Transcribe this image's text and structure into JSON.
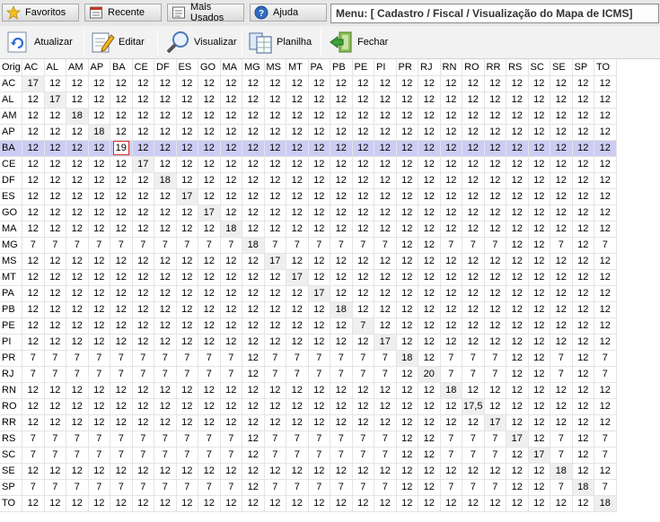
{
  "tabs": [
    {
      "label": "Favoritos",
      "icon": "star-icon"
    },
    {
      "label": "Recente",
      "icon": "recent-icon"
    },
    {
      "label": "Mais Usados",
      "icon": "most-used-icon"
    },
    {
      "label": "Ajuda",
      "icon": "help-icon"
    }
  ],
  "breadcrumb": "Menu: [ Cadastro / Fiscal / Visualização do Mapa de ICMS]",
  "toolbar": [
    {
      "label": "Atualizar",
      "icon": "refresh-icon"
    },
    {
      "label": "Editar",
      "icon": "edit-icon"
    },
    {
      "label": "Visualizar",
      "icon": "magnifier-icon"
    },
    {
      "label": "Planilha",
      "icon": "spreadsheet-icon"
    },
    {
      "label": "Fechar",
      "icon": "exit-icon"
    }
  ],
  "table": {
    "corner": "Orig",
    "columns": [
      "AC",
      "AL",
      "AM",
      "AP",
      "BA",
      "CE",
      "DF",
      "ES",
      "GO",
      "MA",
      "MG",
      "MS",
      "MT",
      "PA",
      "PB",
      "PE",
      "PI",
      "PR",
      "RJ",
      "RN",
      "RO",
      "RR",
      "RS",
      "SC",
      "SE",
      "SP",
      "TO"
    ],
    "selected_row": "BA",
    "active_cell": {
      "row": "BA",
      "col": "BA"
    },
    "rows": [
      {
        "orig": "AC",
        "values": [
          "17",
          "12",
          "12",
          "12",
          "12",
          "12",
          "12",
          "12",
          "12",
          "12",
          "12",
          "12",
          "12",
          "12",
          "12",
          "12",
          "12",
          "12",
          "12",
          "12",
          "12",
          "12",
          "12",
          "12",
          "12",
          "12",
          "12"
        ]
      },
      {
        "orig": "AL",
        "values": [
          "12",
          "17",
          "12",
          "12",
          "12",
          "12",
          "12",
          "12",
          "12",
          "12",
          "12",
          "12",
          "12",
          "12",
          "12",
          "12",
          "12",
          "12",
          "12",
          "12",
          "12",
          "12",
          "12",
          "12",
          "12",
          "12",
          "12"
        ]
      },
      {
        "orig": "AM",
        "values": [
          "12",
          "12",
          "18",
          "12",
          "12",
          "12",
          "12",
          "12",
          "12",
          "12",
          "12",
          "12",
          "12",
          "12",
          "12",
          "12",
          "12",
          "12",
          "12",
          "12",
          "12",
          "12",
          "12",
          "12",
          "12",
          "12",
          "12"
        ]
      },
      {
        "orig": "AP",
        "values": [
          "12",
          "12",
          "12",
          "18",
          "12",
          "12",
          "12",
          "12",
          "12",
          "12",
          "12",
          "12",
          "12",
          "12",
          "12",
          "12",
          "12",
          "12",
          "12",
          "12",
          "12",
          "12",
          "12",
          "12",
          "12",
          "12",
          "12"
        ]
      },
      {
        "orig": "BA",
        "values": [
          "12",
          "12",
          "12",
          "12",
          "19",
          "12",
          "12",
          "12",
          "12",
          "12",
          "12",
          "12",
          "12",
          "12",
          "12",
          "12",
          "12",
          "12",
          "12",
          "12",
          "12",
          "12",
          "12",
          "12",
          "12",
          "12",
          "12"
        ]
      },
      {
        "orig": "CE",
        "values": [
          "12",
          "12",
          "12",
          "12",
          "12",
          "17",
          "12",
          "12",
          "12",
          "12",
          "12",
          "12",
          "12",
          "12",
          "12",
          "12",
          "12",
          "12",
          "12",
          "12",
          "12",
          "12",
          "12",
          "12",
          "12",
          "12",
          "12"
        ]
      },
      {
        "orig": "DF",
        "values": [
          "12",
          "12",
          "12",
          "12",
          "12",
          "12",
          "18",
          "12",
          "12",
          "12",
          "12",
          "12",
          "12",
          "12",
          "12",
          "12",
          "12",
          "12",
          "12",
          "12",
          "12",
          "12",
          "12",
          "12",
          "12",
          "12",
          "12"
        ]
      },
      {
        "orig": "ES",
        "values": [
          "12",
          "12",
          "12",
          "12",
          "12",
          "12",
          "12",
          "17",
          "12",
          "12",
          "12",
          "12",
          "12",
          "12",
          "12",
          "12",
          "12",
          "12",
          "12",
          "12",
          "12",
          "12",
          "12",
          "12",
          "12",
          "12",
          "12"
        ]
      },
      {
        "orig": "GO",
        "values": [
          "12",
          "12",
          "12",
          "12",
          "12",
          "12",
          "12",
          "12",
          "17",
          "12",
          "12",
          "12",
          "12",
          "12",
          "12",
          "12",
          "12",
          "12",
          "12",
          "12",
          "12",
          "12",
          "12",
          "12",
          "12",
          "12",
          "12"
        ]
      },
      {
        "orig": "MA",
        "values": [
          "12",
          "12",
          "12",
          "12",
          "12",
          "12",
          "12",
          "12",
          "12",
          "18",
          "12",
          "12",
          "12",
          "12",
          "12",
          "12",
          "12",
          "12",
          "12",
          "12",
          "12",
          "12",
          "12",
          "12",
          "12",
          "12",
          "12"
        ]
      },
      {
        "orig": "MG",
        "values": [
          "7",
          "7",
          "7",
          "7",
          "7",
          "7",
          "7",
          "7",
          "7",
          "7",
          "18",
          "7",
          "7",
          "7",
          "7",
          "7",
          "7",
          "12",
          "12",
          "7",
          "7",
          "7",
          "12",
          "12",
          "7",
          "12",
          "7"
        ]
      },
      {
        "orig": "MS",
        "values": [
          "12",
          "12",
          "12",
          "12",
          "12",
          "12",
          "12",
          "12",
          "12",
          "12",
          "12",
          "17",
          "12",
          "12",
          "12",
          "12",
          "12",
          "12",
          "12",
          "12",
          "12",
          "12",
          "12",
          "12",
          "12",
          "12",
          "12"
        ]
      },
      {
        "orig": "MT",
        "values": [
          "12",
          "12",
          "12",
          "12",
          "12",
          "12",
          "12",
          "12",
          "12",
          "12",
          "12",
          "12",
          "17",
          "12",
          "12",
          "12",
          "12",
          "12",
          "12",
          "12",
          "12",
          "12",
          "12",
          "12",
          "12",
          "12",
          "12"
        ]
      },
      {
        "orig": "PA",
        "values": [
          "12",
          "12",
          "12",
          "12",
          "12",
          "12",
          "12",
          "12",
          "12",
          "12",
          "12",
          "12",
          "12",
          "17",
          "12",
          "12",
          "12",
          "12",
          "12",
          "12",
          "12",
          "12",
          "12",
          "12",
          "12",
          "12",
          "12"
        ]
      },
      {
        "orig": "PB",
        "values": [
          "12",
          "12",
          "12",
          "12",
          "12",
          "12",
          "12",
          "12",
          "12",
          "12",
          "12",
          "12",
          "12",
          "12",
          "18",
          "12",
          "12",
          "12",
          "12",
          "12",
          "12",
          "12",
          "12",
          "12",
          "12",
          "12",
          "12"
        ]
      },
      {
        "orig": "PE",
        "values": [
          "12",
          "12",
          "12",
          "12",
          "12",
          "12",
          "12",
          "12",
          "12",
          "12",
          "12",
          "12",
          "12",
          "12",
          "12",
          "7",
          "12",
          "12",
          "12",
          "12",
          "12",
          "12",
          "12",
          "12",
          "12",
          "12",
          "12"
        ]
      },
      {
        "orig": "PI",
        "values": [
          "12",
          "12",
          "12",
          "12",
          "12",
          "12",
          "12",
          "12",
          "12",
          "12",
          "12",
          "12",
          "12",
          "12",
          "12",
          "12",
          "17",
          "12",
          "12",
          "12",
          "12",
          "12",
          "12",
          "12",
          "12",
          "12",
          "12"
        ]
      },
      {
        "orig": "PR",
        "values": [
          "7",
          "7",
          "7",
          "7",
          "7",
          "7",
          "7",
          "7",
          "7",
          "7",
          "12",
          "7",
          "7",
          "7",
          "7",
          "7",
          "7",
          "18",
          "12",
          "7",
          "7",
          "7",
          "12",
          "12",
          "7",
          "12",
          "7"
        ]
      },
      {
        "orig": "RJ",
        "values": [
          "7",
          "7",
          "7",
          "7",
          "7",
          "7",
          "7",
          "7",
          "7",
          "7",
          "12",
          "7",
          "7",
          "7",
          "7",
          "7",
          "7",
          "12",
          "20",
          "7",
          "7",
          "7",
          "12",
          "12",
          "7",
          "12",
          "7"
        ]
      },
      {
        "orig": "RN",
        "values": [
          "12",
          "12",
          "12",
          "12",
          "12",
          "12",
          "12",
          "12",
          "12",
          "12",
          "12",
          "12",
          "12",
          "12",
          "12",
          "12",
          "12",
          "12",
          "12",
          "18",
          "12",
          "12",
          "12",
          "12",
          "12",
          "12",
          "12"
        ]
      },
      {
        "orig": "RO",
        "values": [
          "12",
          "12",
          "12",
          "12",
          "12",
          "12",
          "12",
          "12",
          "12",
          "12",
          "12",
          "12",
          "12",
          "12",
          "12",
          "12",
          "12",
          "12",
          "12",
          "12",
          "17,5",
          "12",
          "12",
          "12",
          "12",
          "12",
          "12"
        ]
      },
      {
        "orig": "RR",
        "values": [
          "12",
          "12",
          "12",
          "12",
          "12",
          "12",
          "12",
          "12",
          "12",
          "12",
          "12",
          "12",
          "12",
          "12",
          "12",
          "12",
          "12",
          "12",
          "12",
          "12",
          "12",
          "17",
          "12",
          "12",
          "12",
          "12",
          "12"
        ]
      },
      {
        "orig": "RS",
        "values": [
          "7",
          "7",
          "7",
          "7",
          "7",
          "7",
          "7",
          "7",
          "7",
          "7",
          "12",
          "7",
          "7",
          "7",
          "7",
          "7",
          "7",
          "12",
          "12",
          "7",
          "7",
          "7",
          "17",
          "12",
          "7",
          "12",
          "7"
        ]
      },
      {
        "orig": "SC",
        "values": [
          "7",
          "7",
          "7",
          "7",
          "7",
          "7",
          "7",
          "7",
          "7",
          "7",
          "12",
          "7",
          "7",
          "7",
          "7",
          "7",
          "7",
          "12",
          "12",
          "7",
          "7",
          "7",
          "12",
          "17",
          "7",
          "12",
          "7"
        ]
      },
      {
        "orig": "SE",
        "values": [
          "12",
          "12",
          "12",
          "12",
          "12",
          "12",
          "12",
          "12",
          "12",
          "12",
          "12",
          "12",
          "12",
          "12",
          "12",
          "12",
          "12",
          "12",
          "12",
          "12",
          "12",
          "12",
          "12",
          "12",
          "18",
          "12",
          "12"
        ]
      },
      {
        "orig": "SP",
        "values": [
          "7",
          "7",
          "7",
          "7",
          "7",
          "7",
          "7",
          "7",
          "7",
          "7",
          "12",
          "7",
          "7",
          "7",
          "7",
          "7",
          "7",
          "12",
          "12",
          "7",
          "7",
          "7",
          "12",
          "12",
          "7",
          "18",
          "7"
        ]
      },
      {
        "orig": "TO",
        "values": [
          "12",
          "12",
          "12",
          "12",
          "12",
          "12",
          "12",
          "12",
          "12",
          "12",
          "12",
          "12",
          "12",
          "12",
          "12",
          "12",
          "12",
          "12",
          "12",
          "12",
          "12",
          "12",
          "12",
          "12",
          "12",
          "12",
          "18"
        ]
      }
    ]
  }
}
